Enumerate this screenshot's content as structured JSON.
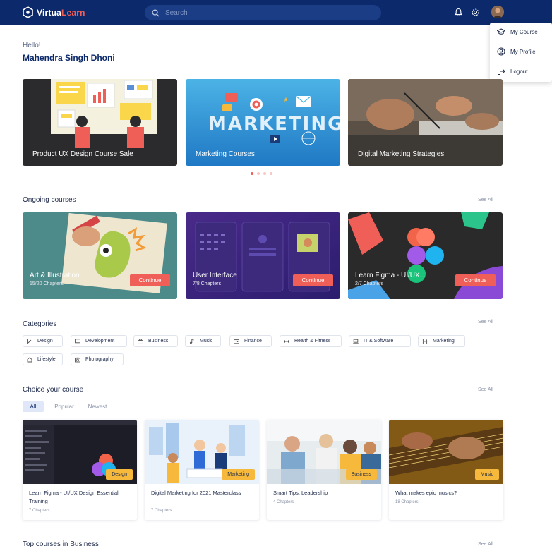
{
  "header": {
    "logo_main": "Virtua",
    "logo_accent": "Learn",
    "search_placeholder": "Search"
  },
  "profile_menu": [
    {
      "label": "My Course",
      "icon": "graduation-cap-icon"
    },
    {
      "label": "My Profile",
      "icon": "user-circle-icon"
    },
    {
      "label": "Logout",
      "icon": "logout-icon"
    }
  ],
  "greeting": {
    "hello": "Hello!",
    "name": "Mahendra Singh Dhoni"
  },
  "banners": [
    {
      "caption": "Product UX Design Course Sale"
    },
    {
      "caption": "Marketing Courses",
      "art_text": "MARKETING"
    },
    {
      "caption": "Digital Marketing Strategies"
    }
  ],
  "carousel": {
    "count": 4,
    "active": 0
  },
  "ongoing": {
    "title": "Ongoing courses",
    "see_all": "See All",
    "continue_label": "Continue",
    "items": [
      {
        "title": "Art & Illustration",
        "chapters": "15/20 Chapters"
      },
      {
        "title": "User Interface",
        "chapters": "7/8 Chapters"
      },
      {
        "title": "Learn Figma - UI/UX...",
        "chapters": "2/7 Chapters"
      }
    ]
  },
  "categories": {
    "title": "Categories",
    "see_all": "See All",
    "items": [
      "Design",
      "Development",
      "Business",
      "Music",
      "Finance",
      "Health & Fitness",
      "IT & Software",
      "Marketing",
      "Lifestyle",
      "Photography"
    ]
  },
  "choice": {
    "title": "Choice your course",
    "see_all": "See All",
    "tabs": [
      "All",
      "Popular",
      "Newest"
    ],
    "active_tab": "All",
    "items": [
      {
        "tag": "Design",
        "title": "Learn Figma - UI/UX Design Essential Training",
        "chapters": "7 Chapters"
      },
      {
        "tag": "Marketing",
        "title": "Digital Marketing for 2021 Masterclass",
        "chapters": "7 Chapters"
      },
      {
        "tag": "Business",
        "title": "Smart Tips: Leadership",
        "chapters": "4 Chapters"
      },
      {
        "tag": "Music",
        "title": "What makes epic musics?",
        "chapters": "18 Chapters"
      }
    ]
  },
  "top_business": {
    "title": "Top courses in Business",
    "see_all": "See All"
  },
  "colors": {
    "navy": "#0c2a6b",
    "accent": "#ef5f57",
    "tag": "#f6b93b"
  }
}
